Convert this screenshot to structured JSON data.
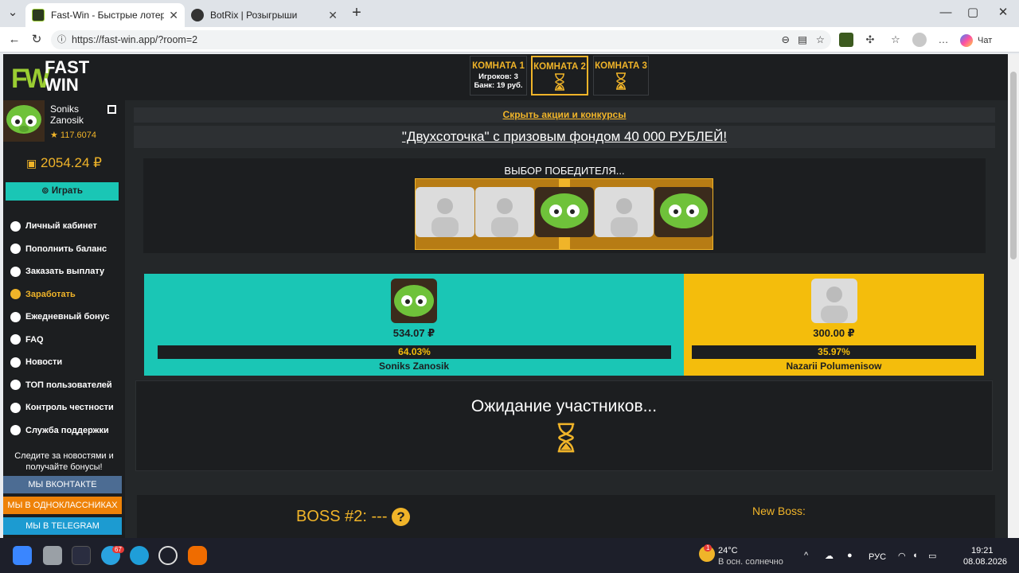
{
  "browser": {
    "tabs": [
      {
        "title": "Fast-Win - Быстрые лотереи! Ком",
        "active": true
      },
      {
        "title": "BotRix | Розыгрыши",
        "active": false
      }
    ],
    "url": "https://fast-win.app/?room=2",
    "chat_label": "Чат"
  },
  "site": {
    "logo": {
      "line1": "FAST",
      "line2": "WIN",
      "mark": "FW"
    },
    "rooms": [
      {
        "title": "КОМНАТА 1",
        "players": "Игроков: 3",
        "bank": "Банк: 19 руб.",
        "active": false
      },
      {
        "title": "КОМНАТА 2",
        "active": true
      },
      {
        "title": "КОМНАТА 3",
        "active": false
      }
    ],
    "user": {
      "name1": "Soniks",
      "name2": "Zanosik",
      "rating": "★ 117.6074",
      "balance": "2054.24 ₽"
    },
    "play_button": "Играть",
    "menu": [
      {
        "label": "Личный кабинет",
        "icon": "briefcase-icon"
      },
      {
        "label": "Пополнить баланс",
        "icon": "arrow-right-circle-icon"
      },
      {
        "label": "Заказать выплату",
        "icon": "arrow-down-circle-icon"
      },
      {
        "label": "Заработать",
        "icon": "earn-icon",
        "highlight": true
      },
      {
        "label": "Ежедневный бонус",
        "icon": "gift-icon"
      },
      {
        "label": "FAQ",
        "icon": "question-icon"
      },
      {
        "label": "Новости",
        "icon": "bookmark-icon"
      },
      {
        "label": "ТОП пользователей",
        "icon": "trophy-icon"
      },
      {
        "label": "Контроль честности",
        "icon": "shuffle-icon"
      },
      {
        "label": "Служба поддержки",
        "icon": "lifebuoy-icon"
      }
    ],
    "follow_text": "Следите за новостями и получайте бонусы!",
    "social": [
      {
        "label": "МЫ ВКОНТАКТЕ",
        "color": "#4c6c93"
      },
      {
        "label": "МЫ В ОДНОКЛАССНИКАХ",
        "color": "#ee8208"
      },
      {
        "label": "МЫ В TELEGRAM",
        "color": "#1c9bd1"
      }
    ],
    "hide_promos": "Скрыть акции и конкурсы",
    "promo": "\"Двухсоточка\" с призовым фондом 40 000 РУБЛЕЙ!",
    "winner_title": "ВЫБОР ПОБЕДИТЕЛЯ...",
    "players": [
      {
        "name": "Soniks Zanosik",
        "amount": "534.07 ₽",
        "percent": "64.03%",
        "share": 0.6403,
        "color": "#1ac6b5"
      },
      {
        "name": "Nazarii Polumenisow",
        "amount": "300.00 ₽",
        "percent": "35.97%",
        "share": 0.3597,
        "color": "#f4bd0c"
      }
    ],
    "waiting": "Ожидание участников...",
    "boss": {
      "label": "BOSS #2: ---",
      "help": "?",
      "new_boss": "New Boss:"
    }
  },
  "taskbar": {
    "weather_temp": "24°C",
    "weather_desc": "В осн. солнечно",
    "lang": "РУС",
    "time": "19:21",
    "date": "08.08.2026",
    "badge": "1",
    "telegram_badge": "67"
  },
  "colors": {
    "accent": "#f0b429",
    "teal": "#1ac6b5",
    "yellow": "#f4bd0c",
    "dark": "#1c1e20"
  }
}
